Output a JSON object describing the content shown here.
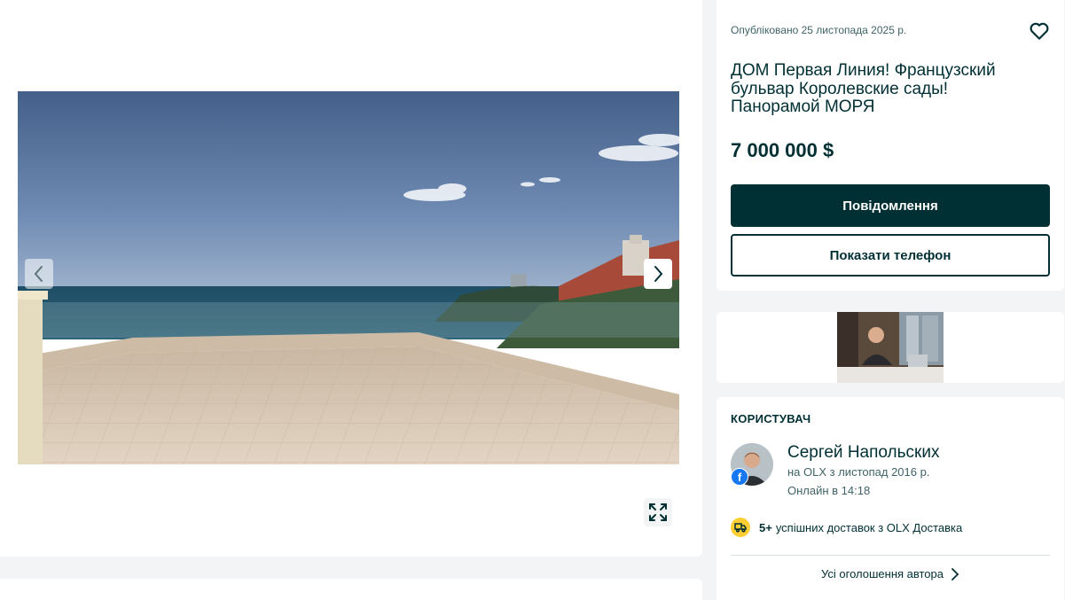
{
  "gallery": {
    "prev_icon": "chevron-left-icon",
    "next_icon": "chevron-right-icon",
    "expand_icon": "fullscreen-expand-icon"
  },
  "listing": {
    "published": "Опубліковано 25 листопада 2025 р.",
    "favorite_icon": "heart-outline-icon",
    "title": "ДОМ Первая Линия! Французский бульвар Королевские сады! Панорамой МОРЯ",
    "price": "7 000 000 $",
    "message_label": "Повідомлення",
    "phone_label": "Показати телефон"
  },
  "user": {
    "heading": "КОРИСТУВАЧ",
    "name": "Сергей Напольских",
    "since": "на OLX з листопад 2016 р.",
    "online": "Онлайн в 14:18",
    "fb_badge": "f",
    "delivery_count": "5+",
    "delivery_text": "успішних доставок з OLX Доставка",
    "all_ads_label": "Усі оголошення автора"
  },
  "colors": {
    "primary": "#002f34",
    "background": "#f2f4f5",
    "delivery_badge": "#ffce32",
    "facebook": "#1877f2"
  }
}
